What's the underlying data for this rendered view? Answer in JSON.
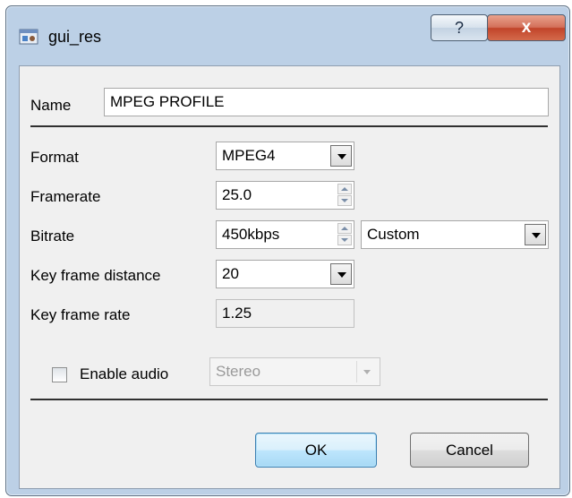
{
  "window": {
    "title": "gui_res",
    "help_label": "?",
    "close_label": "x"
  },
  "name_field": {
    "label": "Name",
    "value": "MPEG PROFILE"
  },
  "format": {
    "label": "Format",
    "value": "MPEG4"
  },
  "framerate": {
    "label": "Framerate",
    "value": "25.0"
  },
  "bitrate": {
    "label": "Bitrate",
    "value": "450kbps",
    "preset": "Custom"
  },
  "key_frame_distance": {
    "label": "Key frame distance",
    "value": "20"
  },
  "key_frame_rate": {
    "label": "Key frame rate",
    "value": "1.25"
  },
  "audio": {
    "label": "Enable audio",
    "checked": false,
    "mode": "Stereo"
  },
  "buttons": {
    "ok": "OK",
    "cancel": "Cancel"
  },
  "colors": {
    "titlebar": "#bcd0e6",
    "client": "#f0f0f0",
    "close_button": "#c1442a",
    "ok_border": "#3c7fb1"
  }
}
